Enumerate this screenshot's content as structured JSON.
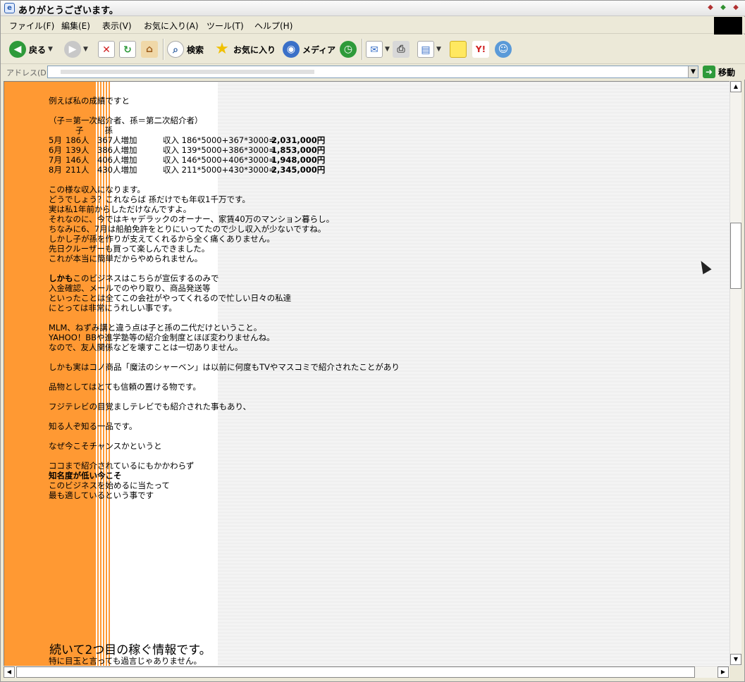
{
  "window": {
    "title": "ありがとうございます。",
    "icon": "ie-page-icon",
    "controls": [
      "minimize-icon",
      "maximize-icon",
      "close-icon"
    ]
  },
  "menu": [
    {
      "label": "ファイル(F)"
    },
    {
      "label": "編集(E)"
    },
    {
      "label": "表示(V)"
    },
    {
      "label": "お気に入り(A)"
    },
    {
      "label": "ツール(T)"
    },
    {
      "label": "ヘルプ(H)"
    }
  ],
  "toolbar": {
    "back_label": "戻る",
    "search_label": "検索",
    "favorites_label": "お気に入り",
    "media_label": "メディア"
  },
  "address": {
    "label": "アドレス(D)",
    "go_label": "移動"
  },
  "content": {
    "intro": "例えば私の成績ですと",
    "legend": "（子＝第一次紹介者、孫＝第二次紹介者）",
    "legend_cols": [
      "子",
      "孫"
    ],
    "sales": [
      {
        "month": "5月",
        "child": "186人",
        "grandchild": "367人増加",
        "formula": "収入 186*5000+367*3000=",
        "total": "2,031,000円"
      },
      {
        "month": "6月",
        "child": "139人",
        "grandchild": "386人増加",
        "formula": "収入 139*5000+386*3000=",
        "total": "1,853,000円"
      },
      {
        "month": "7月",
        "child": "146人",
        "grandchild": "406人増加",
        "formula": "収入 146*5000+406*3000=",
        "total": "1,948,000円"
      },
      {
        "month": "8月",
        "child": "211人",
        "grandchild": "430人増加",
        "formula": "収入 211*5000+430*3000=",
        "total": "2,345,000円"
      }
    ],
    "para1": [
      "この様な収入になります。",
      "どうでしょう？これならば 孫だけでも年収1千万です。",
      "実は私1年前からしただけなんですよ。",
      "それなのに、今ではキャデラックのオーナー、家賃40万のマンション暮らし。",
      "ちなみに6、7月は船舶免許をとりにいってたので少し収入が少ないですね。",
      "しかし子が孫を作りが支えてくれるから全く痛くありません。",
      "先日クルーザーも買って楽しんできました。",
      "これが本当に簡単だからやめられません。"
    ],
    "para2_bold": "しかも",
    "para2_rest": "このビジネスはこちらが宣伝するのみで",
    "para2": [
      "入金確認、メールでのやり取り、商品発送等",
      "といったことは全てこの会社がやってくれるので忙しい日々の私達",
      "にとっては非常にうれしい事です。"
    ],
    "para3": [
      "MLM、ねずみ講と違う点は子と孫の二代だけということ。",
      "YAHOO！BBや進学塾等の紹介金制度とほぼ変わりませんね。",
      "なので、友人関係などを壊すことは一切ありません。"
    ],
    "line_a": "しかも実はコノ商品「魔法のシャーベン」は以前に何度もTVやマスコミで紹介されたことがあり",
    "line_b": "品物としてはとても信頼の置ける物です。",
    "line_c": "フジテレビの目覚ましテレビでも紹介された事もあり、",
    "line_d": "知る人ぞ知る一品です。",
    "line_e": "なぜ今こそチャンスかというと",
    "line_f": "ココまで紹介されているにもかかわらず",
    "line_g_bold": "知名度が低い今こそ",
    "line_h": "このビジネスを始めるに当たって",
    "line_i": "最も適しているという事です",
    "big_heading": "続いて2つ目の稼ぐ情報です。",
    "after_heading": "特に目玉と言っても過言じゃありません。"
  },
  "colors": {
    "sidebar": "#ff9933",
    "background": "#ffffff"
  }
}
